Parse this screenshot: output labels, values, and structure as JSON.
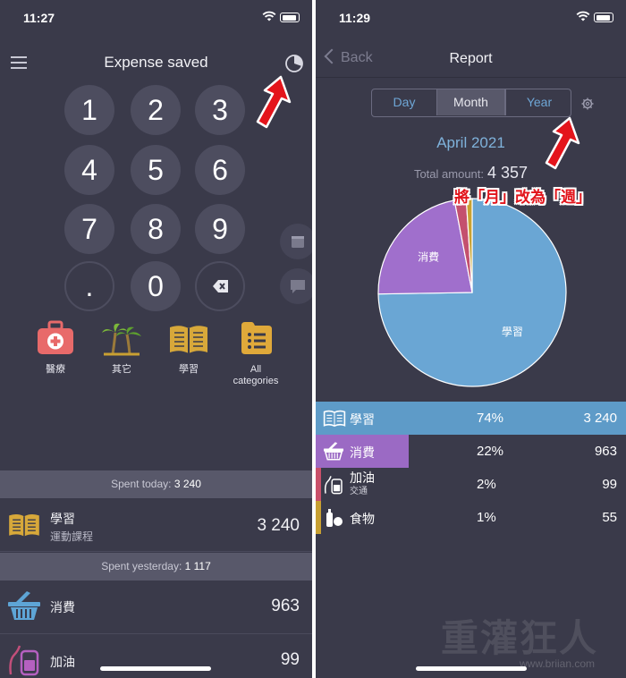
{
  "left": {
    "status_time": "11:27",
    "nav_title": "Expense saved",
    "keypad": [
      "1",
      "2",
      "3",
      "4",
      "5",
      "6",
      "7",
      "8",
      "9",
      ".",
      "0"
    ],
    "categories": [
      {
        "label": "醫療",
        "icon": "medical-kit-icon"
      },
      {
        "label": "其它",
        "icon": "palm-trees-icon"
      },
      {
        "label": "學習",
        "icon": "open-book-icon"
      },
      {
        "label": "All\ncategories",
        "icon": "list-icon"
      }
    ],
    "today_label": "Spent today:",
    "today_value": "3 240",
    "today_entry": {
      "name": "學習",
      "sub": "運動課程",
      "amount": "3 240"
    },
    "yesterday_label": "Spent yesterday:",
    "yesterday_value": "1 117",
    "yesterday_entries": [
      {
        "name": "消費",
        "amount": "963"
      },
      {
        "name": "加油",
        "amount": "99"
      }
    ]
  },
  "right": {
    "status_time": "11:29",
    "back_label": "Back",
    "nav_title": "Report",
    "tabs": [
      "Day",
      "Month",
      "Year"
    ],
    "active_tab": "Month",
    "period": "April 2021",
    "total_label": "Total amount:",
    "total_value": "4 357",
    "annotation": "將「月」改為「週」",
    "rows": [
      {
        "name": "學習",
        "sub": "",
        "pct": "74%",
        "value": "3 240",
        "color": "#5e9bc8"
      },
      {
        "name": "消費",
        "sub": "",
        "pct": "22%",
        "value": "963",
        "color": "#9b6ac4"
      },
      {
        "name": "加油",
        "sub": "交通",
        "pct": "2%",
        "value": "99",
        "color": "#c9506a"
      },
      {
        "name": "食物",
        "sub": "",
        "pct": "1%",
        "value": "55",
        "color": "#c8a032"
      }
    ],
    "chart_data": {
      "type": "pie",
      "categories": [
        "學習",
        "消費",
        "加油",
        "食物"
      ],
      "values": [
        74,
        22,
        2,
        1
      ],
      "colors": [
        "#6aa6d4",
        "#a06fcc",
        "#c4506e",
        "#c9a232"
      ]
    }
  },
  "watermark": {
    "text": "重灌狂人",
    "url": "www.briian.com"
  }
}
